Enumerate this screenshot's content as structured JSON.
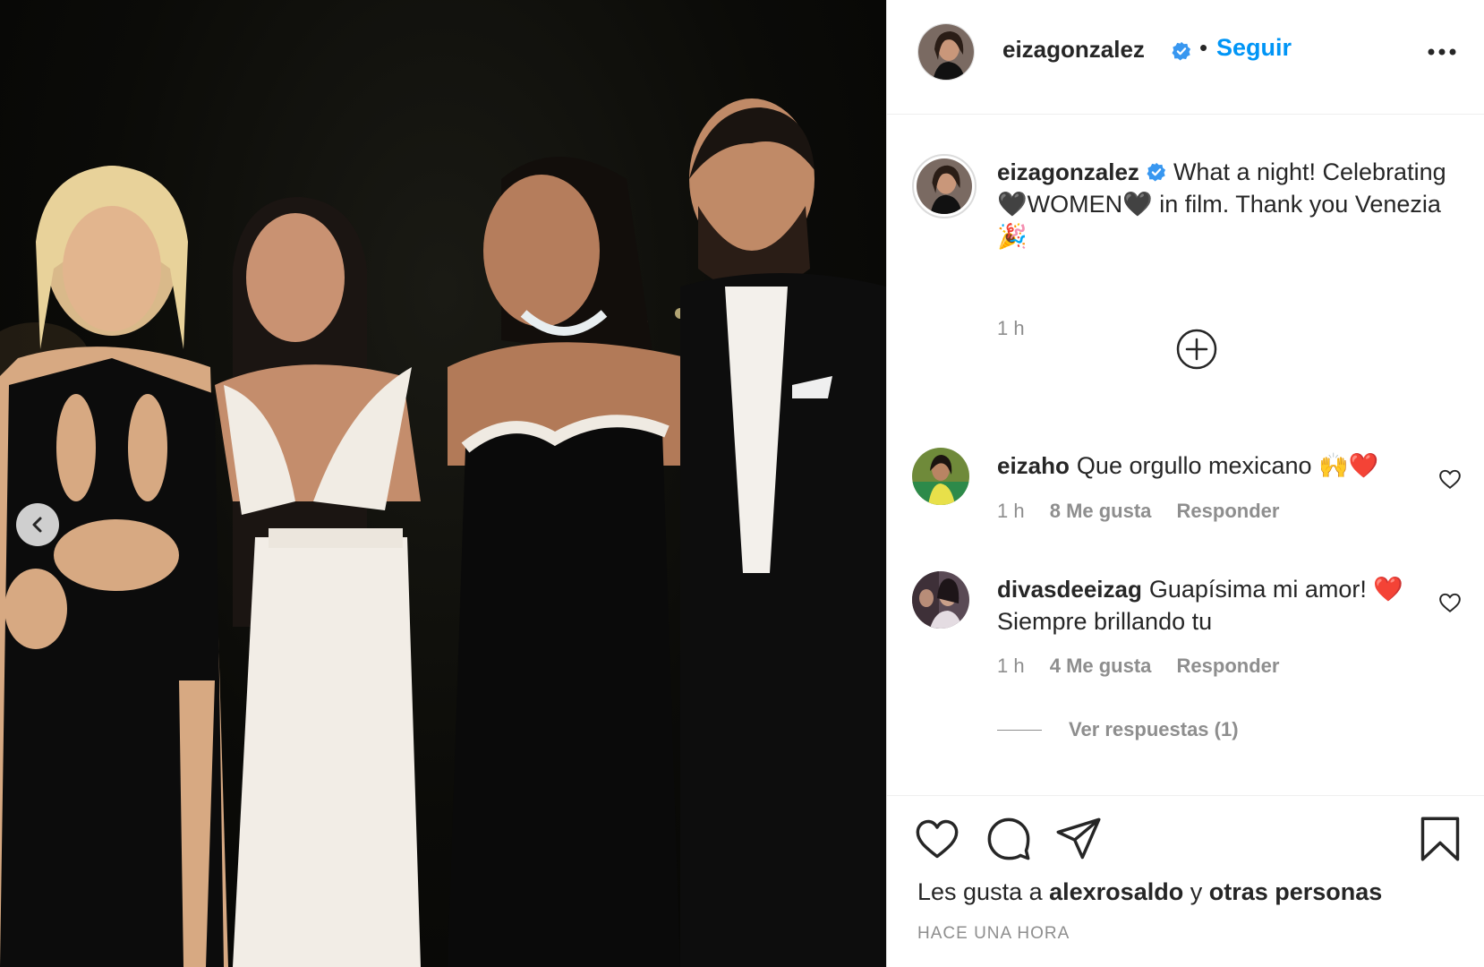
{
  "post": {
    "author": "eizagonzalez",
    "follow_label": "Seguir",
    "dot": "•"
  },
  "caption": {
    "username": "eizagonzalez",
    "text": "What a night! Celebrating 🖤WOMEN🖤 in film. Thank you Venezia 🎉",
    "time": "1 h"
  },
  "comments": [
    {
      "username": "eizaho",
      "text": "Que orgullo mexicano 🙌❤️",
      "time": "1 h",
      "likes": "8 Me gusta",
      "reply": "Responder"
    },
    {
      "username": "divasdeeizag",
      "text": "Guapísima mi amor! ❤️ Siempre brillando tu",
      "time": "1 h",
      "likes": "4 Me gusta",
      "reply": "Responder"
    }
  ],
  "view_replies": "Ver respuestas (1)",
  "likes": {
    "prefix": "Les gusta a",
    "user": "alexrosaldo",
    "connector": "y",
    "others": "otras personas"
  },
  "timestamp": "HACE UNA HORA",
  "icons": {
    "verified": "verified-badge-icon",
    "more": "more-options-icon",
    "add": "add-circle-icon",
    "heart": "heart-icon",
    "comment": "comment-icon",
    "share": "share-icon",
    "save": "save-icon",
    "prev": "chevron-left-icon"
  },
  "colors": {
    "accent": "#0095f6",
    "text": "#262626",
    "secondary": "#8e8e8e",
    "verified": "#3897f0"
  }
}
